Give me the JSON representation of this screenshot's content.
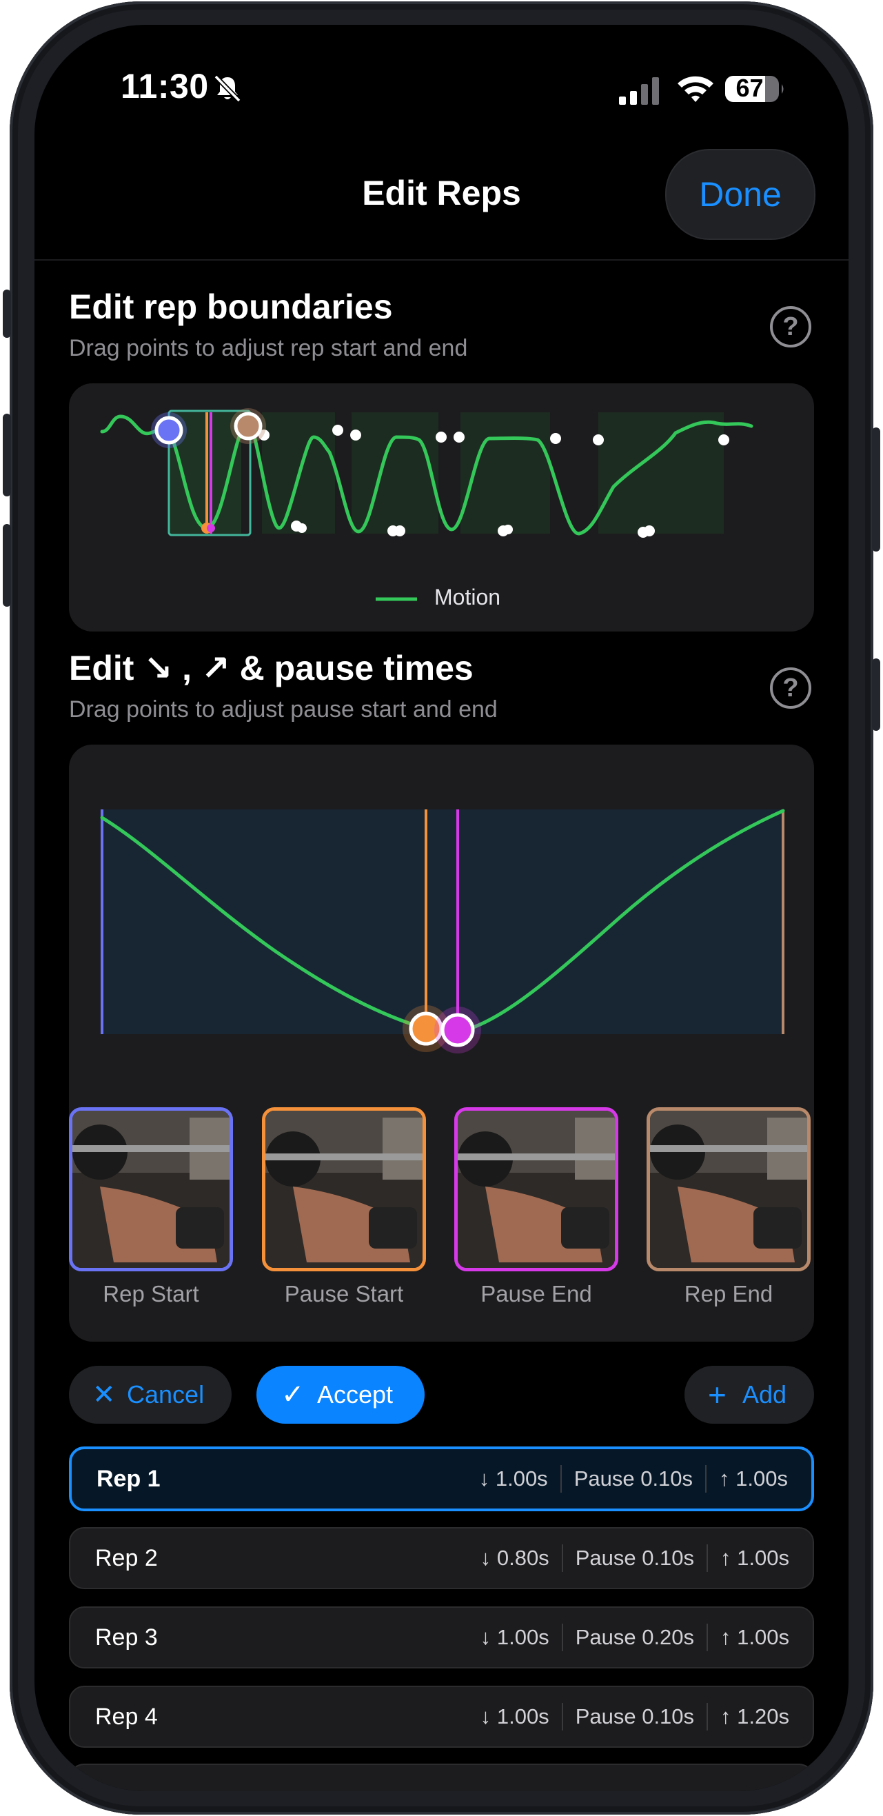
{
  "status_bar": {
    "time": "11:30",
    "battery": "67"
  },
  "nav": {
    "title": "Edit Reps",
    "done_label": "Done"
  },
  "boundaries": {
    "title": "Edit rep boundaries",
    "subtitle": "Drag points to adjust rep start and end",
    "help": "?",
    "legend": "Motion"
  },
  "pause": {
    "title": "Edit ↘ , ↗ & pause times",
    "subtitle": "Drag points to adjust pause start and end",
    "help": "?",
    "thumbs": [
      {
        "label": "Rep Start",
        "color": "#6b73f5"
      },
      {
        "label": "Pause Start",
        "color": "#f5913a"
      },
      {
        "label": "Pause End",
        "color": "#d63ae8"
      },
      {
        "label": "Rep End",
        "color": "#b8896a"
      }
    ]
  },
  "actions": {
    "cancel": "Cancel",
    "accept": "Accept",
    "add": "Add"
  },
  "reps": [
    {
      "name": "Rep 1",
      "down": "↓ 1.00s",
      "pause": "Pause 0.10s",
      "up": "↑ 1.00s"
    },
    {
      "name": "Rep 2",
      "down": "↓ 0.80s",
      "pause": "Pause 0.10s",
      "up": "↑ 1.00s"
    },
    {
      "name": "Rep 3",
      "down": "↓ 1.00s",
      "pause": "Pause 0.20s",
      "up": "↑ 1.00s"
    },
    {
      "name": "Rep 4",
      "down": "↓ 1.00s",
      "pause": "Pause 0.10s",
      "up": "↑ 1.20s"
    }
  ],
  "colors": {
    "accent": "#1a8fff",
    "motion": "#34c759"
  }
}
